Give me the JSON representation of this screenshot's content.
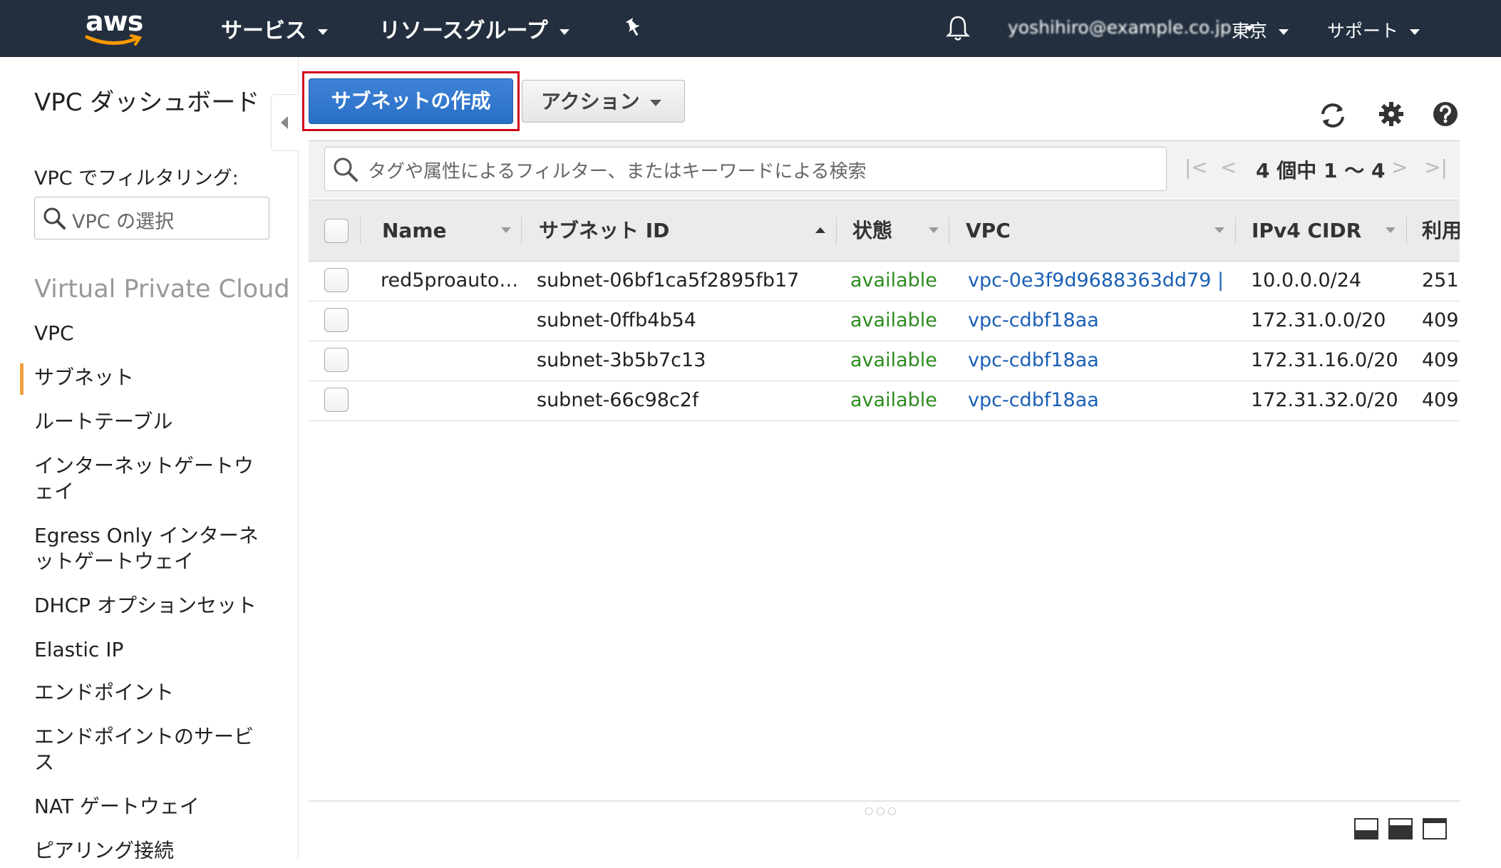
{
  "nav": {
    "logo": "aws",
    "services": "サービス",
    "resource_groups": "リソースグループ",
    "account": "yoshihiro@example.co.jp",
    "region": "東京",
    "support": "サポート"
  },
  "sidebar": {
    "title": "VPC ダッシュボード",
    "filter_label": "VPC でフィルタリング:",
    "filter_placeholder": "VPC の選択",
    "section": "Virtual Private Cloud",
    "items": [
      {
        "label": "VPC"
      },
      {
        "label": "サブネット"
      },
      {
        "label": "ルートテーブル"
      },
      {
        "label": "インターネットゲートウェイ"
      },
      {
        "label": "Egress Only インターネットゲートウェイ"
      },
      {
        "label": "DHCP オプションセット"
      },
      {
        "label": "Elastic IP"
      },
      {
        "label": "エンドポイント"
      },
      {
        "label": "エンドポイントのサービス"
      },
      {
        "label": "NAT ゲートウェイ"
      },
      {
        "label": "ピアリング接続"
      }
    ]
  },
  "toolbar": {
    "create_subnet": "サブネットの作成",
    "actions": "アクション"
  },
  "search": {
    "placeholder": "タグや属性によるフィルター、またはキーワードによる検索"
  },
  "pager": {
    "text": "4 個中 1 〜 4"
  },
  "table": {
    "columns": [
      "Name",
      "サブネット ID",
      "状態",
      "VPC",
      "IPv4 CIDR",
      "利用"
    ],
    "rows": [
      {
        "name": "red5proauto…",
        "subnet_id": "subnet-06bf1ca5f2895fb17",
        "state": "available",
        "vpc": "vpc-0e3f9d9688363dd79 |…",
        "cidr": "10.0.0.0/24",
        "available": "251"
      },
      {
        "name": "",
        "subnet_id": "subnet-0ffb4b54",
        "state": "available",
        "vpc": "vpc-cdbf18aa",
        "cidr": "172.31.0.0/20",
        "available": "409"
      },
      {
        "name": "",
        "subnet_id": "subnet-3b5b7c13",
        "state": "available",
        "vpc": "vpc-cdbf18aa",
        "cidr": "172.31.16.0/20",
        "available": "409"
      },
      {
        "name": "",
        "subnet_id": "subnet-66c98c2f",
        "state": "available",
        "vpc": "vpc-cdbf18aa",
        "cidr": "172.31.32.0/20",
        "available": "409"
      }
    ]
  },
  "colors": {
    "nav_bg": "#232f3e",
    "primary_button": "#2a6fc7",
    "highlight": "#d0021b",
    "available": "#2d8a1f",
    "link": "#1a5fb4",
    "active_bar": "#f0a042"
  }
}
